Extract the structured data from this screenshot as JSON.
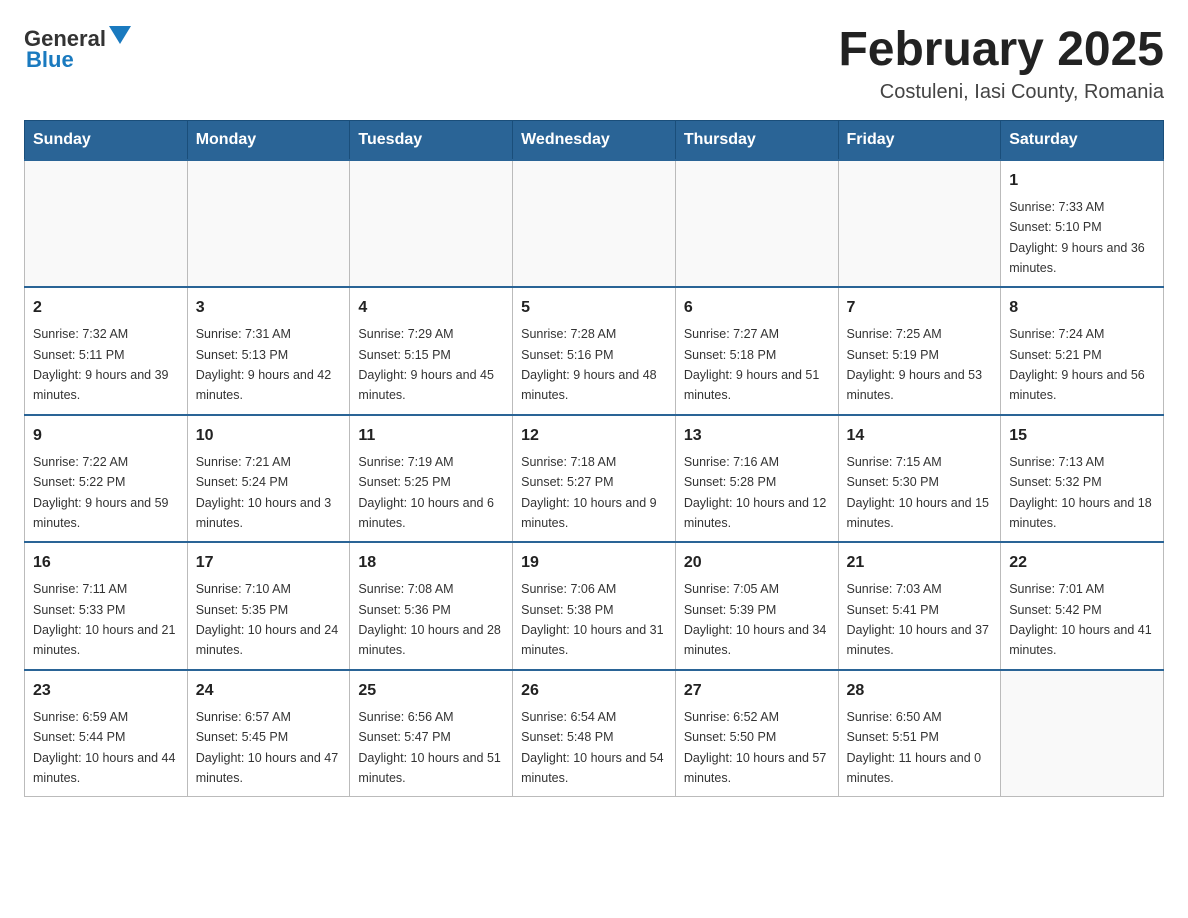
{
  "header": {
    "logo_general": "General",
    "logo_blue": "Blue",
    "title": "February 2025",
    "subtitle": "Costuleni, Iasi County, Romania"
  },
  "calendar": {
    "days_of_week": [
      "Sunday",
      "Monday",
      "Tuesday",
      "Wednesday",
      "Thursday",
      "Friday",
      "Saturday"
    ],
    "weeks": [
      [
        {
          "day": "",
          "info": ""
        },
        {
          "day": "",
          "info": ""
        },
        {
          "day": "",
          "info": ""
        },
        {
          "day": "",
          "info": ""
        },
        {
          "day": "",
          "info": ""
        },
        {
          "day": "",
          "info": ""
        },
        {
          "day": "1",
          "info": "Sunrise: 7:33 AM\nSunset: 5:10 PM\nDaylight: 9 hours and 36 minutes."
        }
      ],
      [
        {
          "day": "2",
          "info": "Sunrise: 7:32 AM\nSunset: 5:11 PM\nDaylight: 9 hours and 39 minutes."
        },
        {
          "day": "3",
          "info": "Sunrise: 7:31 AM\nSunset: 5:13 PM\nDaylight: 9 hours and 42 minutes."
        },
        {
          "day": "4",
          "info": "Sunrise: 7:29 AM\nSunset: 5:15 PM\nDaylight: 9 hours and 45 minutes."
        },
        {
          "day": "5",
          "info": "Sunrise: 7:28 AM\nSunset: 5:16 PM\nDaylight: 9 hours and 48 minutes."
        },
        {
          "day": "6",
          "info": "Sunrise: 7:27 AM\nSunset: 5:18 PM\nDaylight: 9 hours and 51 minutes."
        },
        {
          "day": "7",
          "info": "Sunrise: 7:25 AM\nSunset: 5:19 PM\nDaylight: 9 hours and 53 minutes."
        },
        {
          "day": "8",
          "info": "Sunrise: 7:24 AM\nSunset: 5:21 PM\nDaylight: 9 hours and 56 minutes."
        }
      ],
      [
        {
          "day": "9",
          "info": "Sunrise: 7:22 AM\nSunset: 5:22 PM\nDaylight: 9 hours and 59 minutes."
        },
        {
          "day": "10",
          "info": "Sunrise: 7:21 AM\nSunset: 5:24 PM\nDaylight: 10 hours and 3 minutes."
        },
        {
          "day": "11",
          "info": "Sunrise: 7:19 AM\nSunset: 5:25 PM\nDaylight: 10 hours and 6 minutes."
        },
        {
          "day": "12",
          "info": "Sunrise: 7:18 AM\nSunset: 5:27 PM\nDaylight: 10 hours and 9 minutes."
        },
        {
          "day": "13",
          "info": "Sunrise: 7:16 AM\nSunset: 5:28 PM\nDaylight: 10 hours and 12 minutes."
        },
        {
          "day": "14",
          "info": "Sunrise: 7:15 AM\nSunset: 5:30 PM\nDaylight: 10 hours and 15 minutes."
        },
        {
          "day": "15",
          "info": "Sunrise: 7:13 AM\nSunset: 5:32 PM\nDaylight: 10 hours and 18 minutes."
        }
      ],
      [
        {
          "day": "16",
          "info": "Sunrise: 7:11 AM\nSunset: 5:33 PM\nDaylight: 10 hours and 21 minutes."
        },
        {
          "day": "17",
          "info": "Sunrise: 7:10 AM\nSunset: 5:35 PM\nDaylight: 10 hours and 24 minutes."
        },
        {
          "day": "18",
          "info": "Sunrise: 7:08 AM\nSunset: 5:36 PM\nDaylight: 10 hours and 28 minutes."
        },
        {
          "day": "19",
          "info": "Sunrise: 7:06 AM\nSunset: 5:38 PM\nDaylight: 10 hours and 31 minutes."
        },
        {
          "day": "20",
          "info": "Sunrise: 7:05 AM\nSunset: 5:39 PM\nDaylight: 10 hours and 34 minutes."
        },
        {
          "day": "21",
          "info": "Sunrise: 7:03 AM\nSunset: 5:41 PM\nDaylight: 10 hours and 37 minutes."
        },
        {
          "day": "22",
          "info": "Sunrise: 7:01 AM\nSunset: 5:42 PM\nDaylight: 10 hours and 41 minutes."
        }
      ],
      [
        {
          "day": "23",
          "info": "Sunrise: 6:59 AM\nSunset: 5:44 PM\nDaylight: 10 hours and 44 minutes."
        },
        {
          "day": "24",
          "info": "Sunrise: 6:57 AM\nSunset: 5:45 PM\nDaylight: 10 hours and 47 minutes."
        },
        {
          "day": "25",
          "info": "Sunrise: 6:56 AM\nSunset: 5:47 PM\nDaylight: 10 hours and 51 minutes."
        },
        {
          "day": "26",
          "info": "Sunrise: 6:54 AM\nSunset: 5:48 PM\nDaylight: 10 hours and 54 minutes."
        },
        {
          "day": "27",
          "info": "Sunrise: 6:52 AM\nSunset: 5:50 PM\nDaylight: 10 hours and 57 minutes."
        },
        {
          "day": "28",
          "info": "Sunrise: 6:50 AM\nSunset: 5:51 PM\nDaylight: 11 hours and 0 minutes."
        },
        {
          "day": "",
          "info": ""
        }
      ]
    ]
  }
}
